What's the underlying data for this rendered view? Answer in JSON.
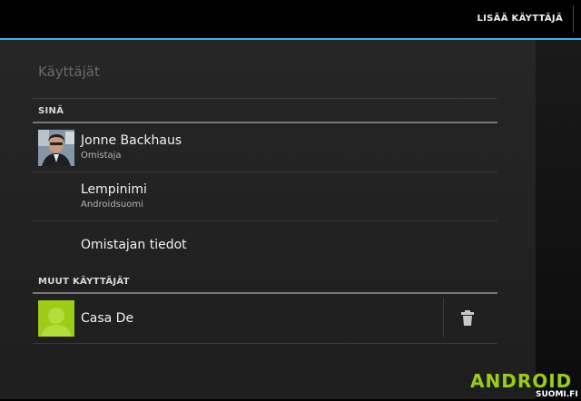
{
  "action_bar": {
    "add_user_label": "LISÄÄ KÄYTTÄJÄ"
  },
  "page": {
    "title": "Käyttäjät"
  },
  "sections": {
    "me": {
      "header": "SINÄ",
      "profile": {
        "name": "Jonne Backhaus",
        "role": "Omistaja"
      },
      "nickname": {
        "title": "Lempinimi",
        "value": "Androidsuomi"
      },
      "owner_info": {
        "title": "Omistajan tiedot"
      }
    },
    "others": {
      "header": "MUUT KÄYTTÄJÄT",
      "users": [
        {
          "name": "Casa De"
        }
      ]
    }
  },
  "icons": {
    "delete": "trash-icon",
    "default_avatar": "user-silhouette-icon",
    "profile_avatar": "profile-photo"
  },
  "watermark": {
    "logo_text": "ANDROID",
    "sub_text": "SUOMI.FI"
  },
  "colors": {
    "accent": "#33b5e5",
    "default_avatar": "#9ccc17",
    "panel": "#262626"
  }
}
